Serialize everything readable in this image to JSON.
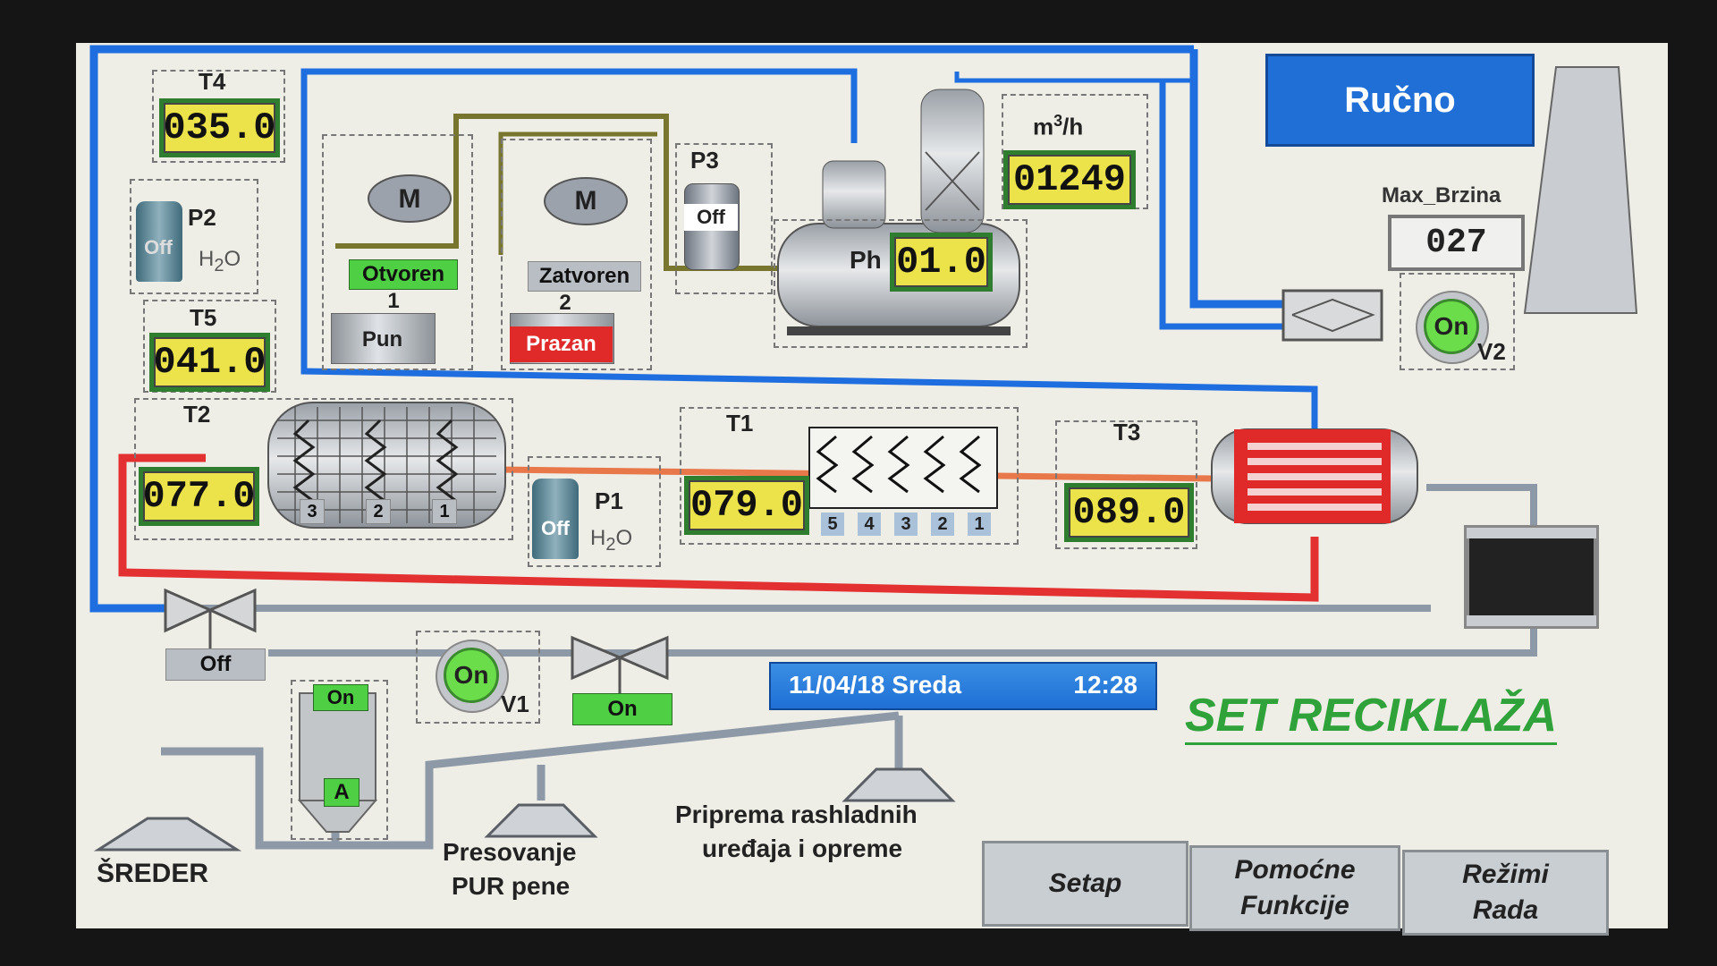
{
  "mode_button": "Ručno",
  "sensors": {
    "T4": {
      "label": "T4",
      "value": "035.0"
    },
    "T5": {
      "label": "T5",
      "value": "041.0"
    },
    "T2": {
      "label": "T2",
      "value": "077.0"
    },
    "T1": {
      "label": "T1",
      "value": "079.0"
    },
    "T3": {
      "label": "T3",
      "value": "089.0"
    }
  },
  "flow": {
    "unit_prefix": "m",
    "unit_sup": "3",
    "unit_suffix": "/h",
    "value": "01249"
  },
  "ph": {
    "label": "Ph",
    "value": "01.0"
  },
  "max_speed": {
    "label": "Max_Brzina",
    "value": "027"
  },
  "pumps": {
    "P1": {
      "label": "P1",
      "state": "Off",
      "medium_h": "H",
      "medium_sub": "2",
      "medium_o": "O"
    },
    "P2": {
      "label": "P2",
      "state": "Off",
      "medium_h": "H",
      "medium_sub": "2",
      "medium_o": "O"
    },
    "P3": {
      "label": "P3",
      "state": "Off"
    }
  },
  "mixers": {
    "m1": {
      "motor": "M",
      "state": "Otvoren",
      "number": "1",
      "level": "Pun"
    },
    "m2": {
      "motor": "M",
      "state": "Zatvoren",
      "number": "2",
      "level": "Prazan"
    }
  },
  "heater_t2_segments": [
    "3",
    "2",
    "1"
  ],
  "heater_t1_segments": [
    "5",
    "4",
    "3",
    "2",
    "1"
  ],
  "fans": {
    "V1": {
      "label": "V1",
      "state": "On"
    },
    "V2": {
      "label": "V2",
      "state": "On"
    }
  },
  "valves": {
    "left": {
      "state": "Off"
    },
    "right": {
      "state": "On"
    }
  },
  "filter": {
    "state": "On",
    "label": "A"
  },
  "status_bar": {
    "date": "11/04/18 Sreda",
    "time": "12:28"
  },
  "screen_title": "SET RECIKLAŽA",
  "stations": {
    "shredder": "ŠREDER",
    "press_line1": "Presovanje",
    "press_line2": "PUR pene",
    "prep_line1": "Priprema rashladnih",
    "prep_line2": "uređaja i opreme"
  },
  "nav_buttons": {
    "setup": "Setap",
    "aux_line1": "Pomoćne",
    "aux_line2": "Funkcije",
    "modes_line1": "Režimi",
    "modes_line2": "Rada"
  },
  "colors": {
    "cold_pipe": "#1e6ee0",
    "hot_pipe": "#e33030",
    "accent_blue": "#1f6fd6",
    "display_yellow": "#ece34a",
    "status_green": "#4fcf43"
  }
}
